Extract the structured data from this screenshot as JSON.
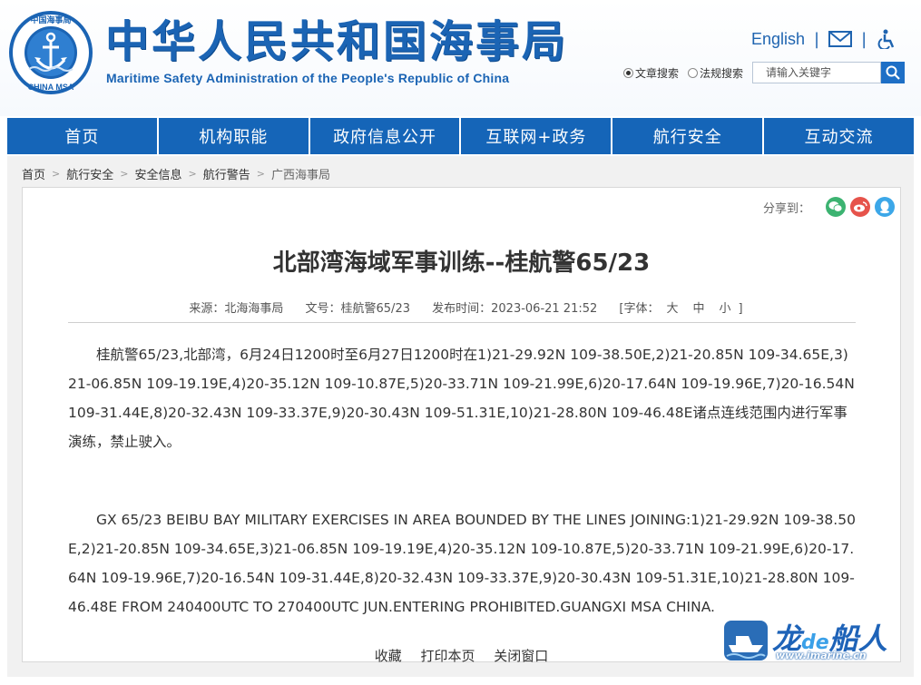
{
  "header": {
    "title_cn": "中华人民共和国海事局",
    "title_en": "Maritime Safety Administration of the People's Republic of China",
    "logo_top_text": "中国海事局",
    "logo_bottom_text": "CHINA MSA",
    "english_link": "English",
    "separator": "|",
    "search": {
      "radio_article": "文章搜索",
      "radio_law": "法规搜索",
      "placeholder": "请输入关键字"
    }
  },
  "nav": {
    "items": [
      "首页",
      "机构职能",
      "政府信息公开",
      "互联网+政务",
      "航行安全",
      "互动交流"
    ]
  },
  "breadcrumb": {
    "items": [
      "首页",
      "航行安全",
      "安全信息",
      "航行警告",
      "广西海事局"
    ],
    "separator": ">"
  },
  "share": {
    "label": "分享到："
  },
  "article": {
    "title": "北部湾海域军事训练--桂航警65/23",
    "source": "来源：北海海事局",
    "doc_no": "文号：桂航警65/23",
    "publish_time": "发布时间：2023-06-21 21:52",
    "font_label": "[字体：",
    "font_large": "大",
    "font_medium": "中",
    "font_small": "小",
    "font_close": "]",
    "body_cn": "桂航警65/23,北部湾，6月24日1200时至6月27日1200时在1)21-29.92N 109-38.50E,2)21-20.85N 109-34.65E,3)21-06.85N 109-19.19E,4)20-35.12N 109-10.87E,5)20-33.71N 109-21.99E,6)20-17.64N 109-19.96E,7)20-16.54N 109-31.44E,8)20-32.43N 109-33.37E,9)20-30.43N 109-51.31E,10)21-28.80N 109-46.48E诸点连线范围内进行军事演练，禁止驶入。",
    "body_en": "GX 65/23 BEIBU BAY MILITARY EXERCISES IN AREA BOUNDED BY THE LINES JOINING:1)21-29.92N 109-38.50E,2)21-20.85N 109-34.65E,3)21-06.85N 109-19.19E,4)20-35.12N 109-10.87E,5)20-33.71N 109-21.99E,6)20-17.64N 109-19.96E,7)20-16.54N 109-31.44E,8)20-32.43N 109-33.37E,9)20-30.43N 109-51.31E,10)21-28.80N 109-46.48E FROM 240400UTC TO 270400UTC JUN.ENTERING PROHIBITED.GUANGXI MSA CHINA."
  },
  "footer": {
    "favorite": "收藏",
    "print": "打印本页",
    "close": "关闭窗口"
  },
  "watermark": {
    "text_a": "龙",
    "text_de": "de",
    "text_b": "船人",
    "url": "www.imarine.cn"
  },
  "colors": {
    "brand_blue": "#1565b8",
    "title_blue": "#1b64b4",
    "wechat_green": "#3cb371",
    "weibo_red": "#e6534b",
    "qq_blue": "#3ca7e8"
  },
  "icons": [
    "logo-emblem",
    "mail-icon",
    "accessibility-icon",
    "search-icon",
    "wechat-icon",
    "weibo-icon",
    "qq-icon"
  ]
}
